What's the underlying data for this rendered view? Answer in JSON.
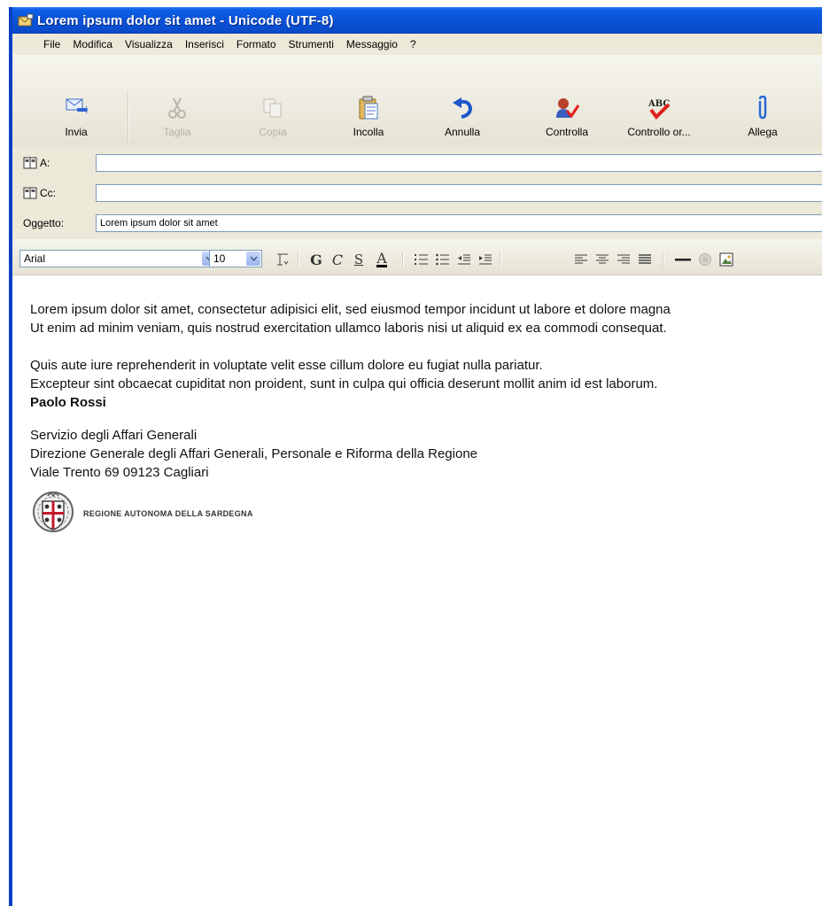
{
  "window": {
    "title": "Lorem ipsum dolor sit amet - Unicode (UTF-8)"
  },
  "menu": [
    "File",
    "Modifica",
    "Visualizza",
    "Inserisci",
    "Formato",
    "Strumenti",
    "Messaggio",
    "?"
  ],
  "toolbar": {
    "send": "Invia",
    "cut": "Taglia",
    "copy": "Copia",
    "paste": "Incolla",
    "undo": "Annulla",
    "check": "Controlla",
    "spell": "Controllo or...",
    "attach": "Allega"
  },
  "headers": {
    "to_label": "A:",
    "cc_label": "Cc:",
    "subject_label": "Oggetto:",
    "to_value": "",
    "cc_value": "",
    "subject_value": "Lorem ipsum dolor sit amet"
  },
  "format": {
    "font": "Arial",
    "size": "10"
  },
  "message": {
    "line1": "Lorem ipsum dolor sit amet, consectetur adipisici elit, sed eiusmod tempor incidunt ut labore et dolore magna",
    "line2": "Ut enim ad minim veniam, quis nostrud exercitation ullamco laboris nisi ut aliquid ex ea commodi consequat.",
    "line3": "Quis aute iure reprehenderit in voluptate velit esse cillum dolore eu fugiat nulla pariatur.",
    "line4": "Excepteur sint obcaecat cupiditat non proident, sunt in culpa qui officia deserunt mollit anim id est laborum."
  },
  "signature": {
    "name": "Paolo Rossi",
    "dept": "Servizio degli Affari Generali",
    "direction": "Direzione Generale degli Affari Generali, Personale e Riforma della Regione",
    "address": "Viale Trento 69  09123 Cagliari",
    "logo_text": "REGIONE AUTONOMA DELLA SARDEGNA"
  },
  "colors": {
    "titlebar": "#0a52d6",
    "chrome": "#ece9d8",
    "spellcheck": "#e0201a",
    "attach": "#2a6bd6"
  }
}
